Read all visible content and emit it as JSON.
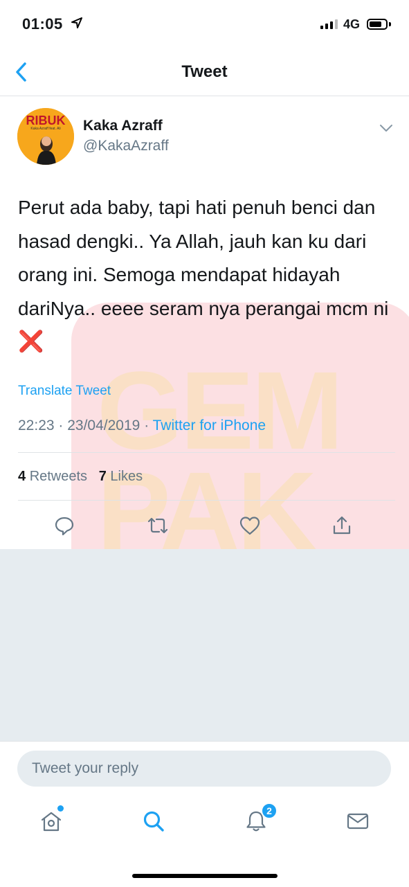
{
  "status_bar": {
    "time": "01:05",
    "network": "4G"
  },
  "nav": {
    "title": "Tweet"
  },
  "tweet": {
    "display_name": "Kaka Azraff",
    "handle": "@KakaAzraff",
    "avatar_text": "RIBUK",
    "avatar_subtext": "Kaka Azraff feat. Ali",
    "text": "Perut ada baby, tapi hati penuh benci dan hasad dengki.. Ya Allah, jauh kan ku dari orang ini. Semoga mendapat hidayah dariNya.. eeee seram nya perangai mcm ni",
    "emoji": "❌",
    "translate_label": "Translate Tweet",
    "time": "22:23",
    "date": "23/04/2019",
    "source": "Twitter for iPhone",
    "retweets_count": "4",
    "retweets_label": "Retweets",
    "likes_count": "7",
    "likes_label": "Likes"
  },
  "watermark": {
    "line1": "GEM",
    "line2": "PAK"
  },
  "reply": {
    "placeholder": "Tweet your reply"
  },
  "tab_bar": {
    "notifications_badge": "2"
  },
  "colors": {
    "accent": "#1da1f2",
    "secondary_text": "#657786",
    "divider": "#dfe3e6",
    "background_gray": "#e6ecf0"
  }
}
